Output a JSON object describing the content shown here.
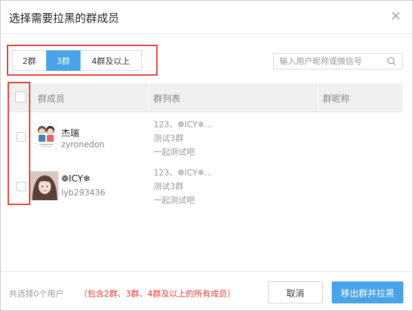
{
  "dialog": {
    "title": "选择需要拉黑的群成员"
  },
  "tabs": [
    {
      "label": "2群"
    },
    {
      "label": "3群"
    },
    {
      "label": "4群及以上"
    }
  ],
  "search": {
    "placeholder": "输入用户昵称或微信号"
  },
  "table": {
    "columns": [
      "群成员",
      "群列表",
      "群昵称"
    ],
    "rows": [
      {
        "name": "杰瑞",
        "uid": "zyronedon",
        "groups": [
          "123、❁ICY❄...",
          "测试3群",
          "一起测试吧"
        ],
        "nickname": ""
      },
      {
        "name": "❁ICY❄",
        "uid": "lyb293436",
        "groups": [
          "123、❁ICY❄...",
          "测试3群",
          "一起测试吧"
        ],
        "nickname": ""
      }
    ]
  },
  "footer": {
    "count_text": "共选择0个用户",
    "note": "（包含2群、3群、4群及以上的所有成员）",
    "cancel_label": "取消",
    "confirm_label": "移出群并拉黑"
  },
  "colors": {
    "accent": "#4aa3e8",
    "highlight": "#e53935"
  },
  "icons": {
    "close": "close-icon",
    "search": "search-icon"
  }
}
